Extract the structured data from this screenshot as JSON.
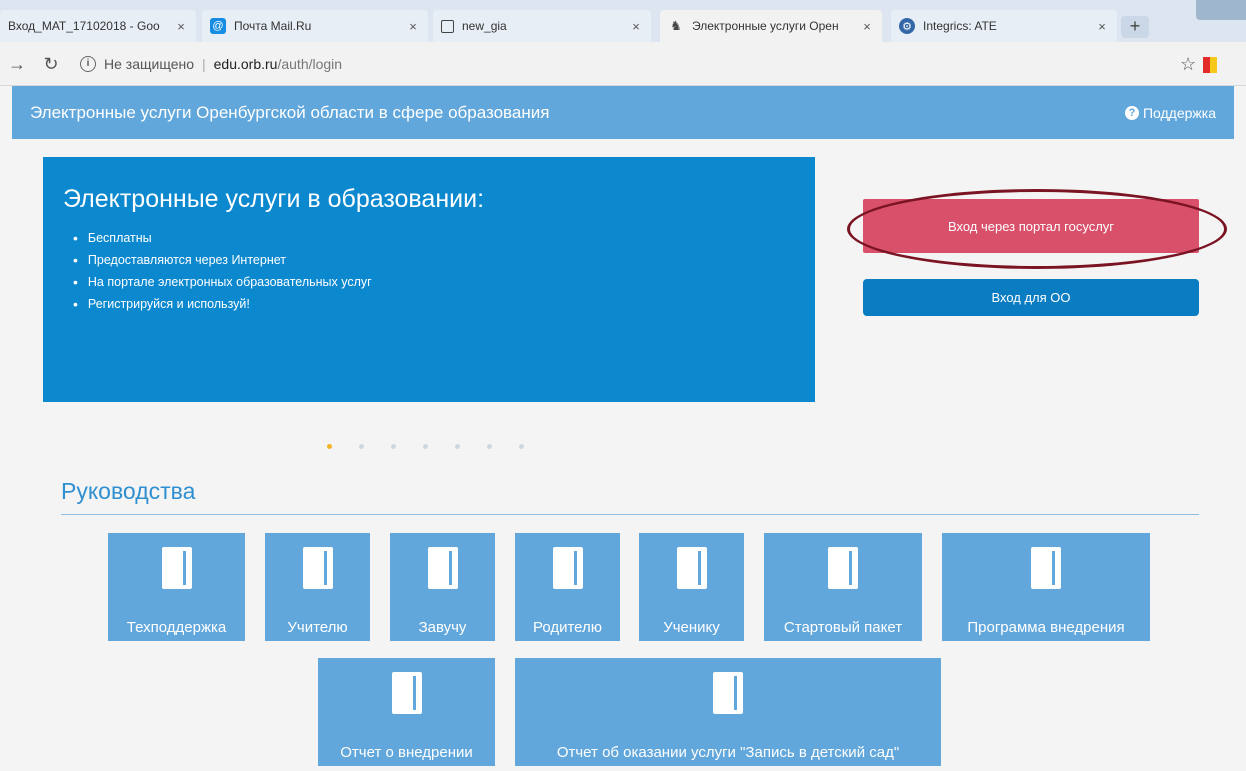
{
  "browser": {
    "tabs": [
      {
        "title": "Вход_MAT_17102018 - Goo",
        "close": "×",
        "active": false
      },
      {
        "title": "Почта Mail.Ru",
        "close": "×",
        "active": false
      },
      {
        "title": "new_gia",
        "close": "×",
        "active": false
      },
      {
        "title": "Электронные услуги Орен",
        "close": "×",
        "active": true
      },
      {
        "title": "Integrics: ATE",
        "close": "×",
        "active": false
      }
    ],
    "new_tab": "+",
    "address": {
      "security": "Не защищено",
      "host": "edu.orb.ru",
      "path": "/auth/login"
    },
    "star": "☆"
  },
  "header": {
    "title": "Электронные услуги Оренбургской области в сфере образования",
    "support": "Поддержка"
  },
  "hero": {
    "title": "Электронные услуги в образовании:",
    "items": [
      "Бесплатны",
      "Предоставляются через Интернет",
      "На портале электронных образовательных услуг",
      "Регистрируйся и используй!"
    ]
  },
  "login": {
    "gosuslugi": "Вход через портал госуслуг",
    "oo": "Вход для ОО"
  },
  "carousel": {
    "count": 7,
    "active": 0
  },
  "guides": {
    "title": "Руководства",
    "tiles": [
      "Техподдержка",
      "Учителю",
      "Завучу",
      "Родителю",
      "Ученику",
      "Стартовый пакет",
      "Программа внедрения",
      "Отчет о внедрении",
      "Отчет об оказании услуги \"Запись в детский сад\""
    ]
  },
  "colors": {
    "header": "#62a7dc",
    "hero": "#0c88cf",
    "gosuslugi": "#d9506b",
    "oo": "#0a7cc2",
    "accent_dot": "#f2b328"
  }
}
